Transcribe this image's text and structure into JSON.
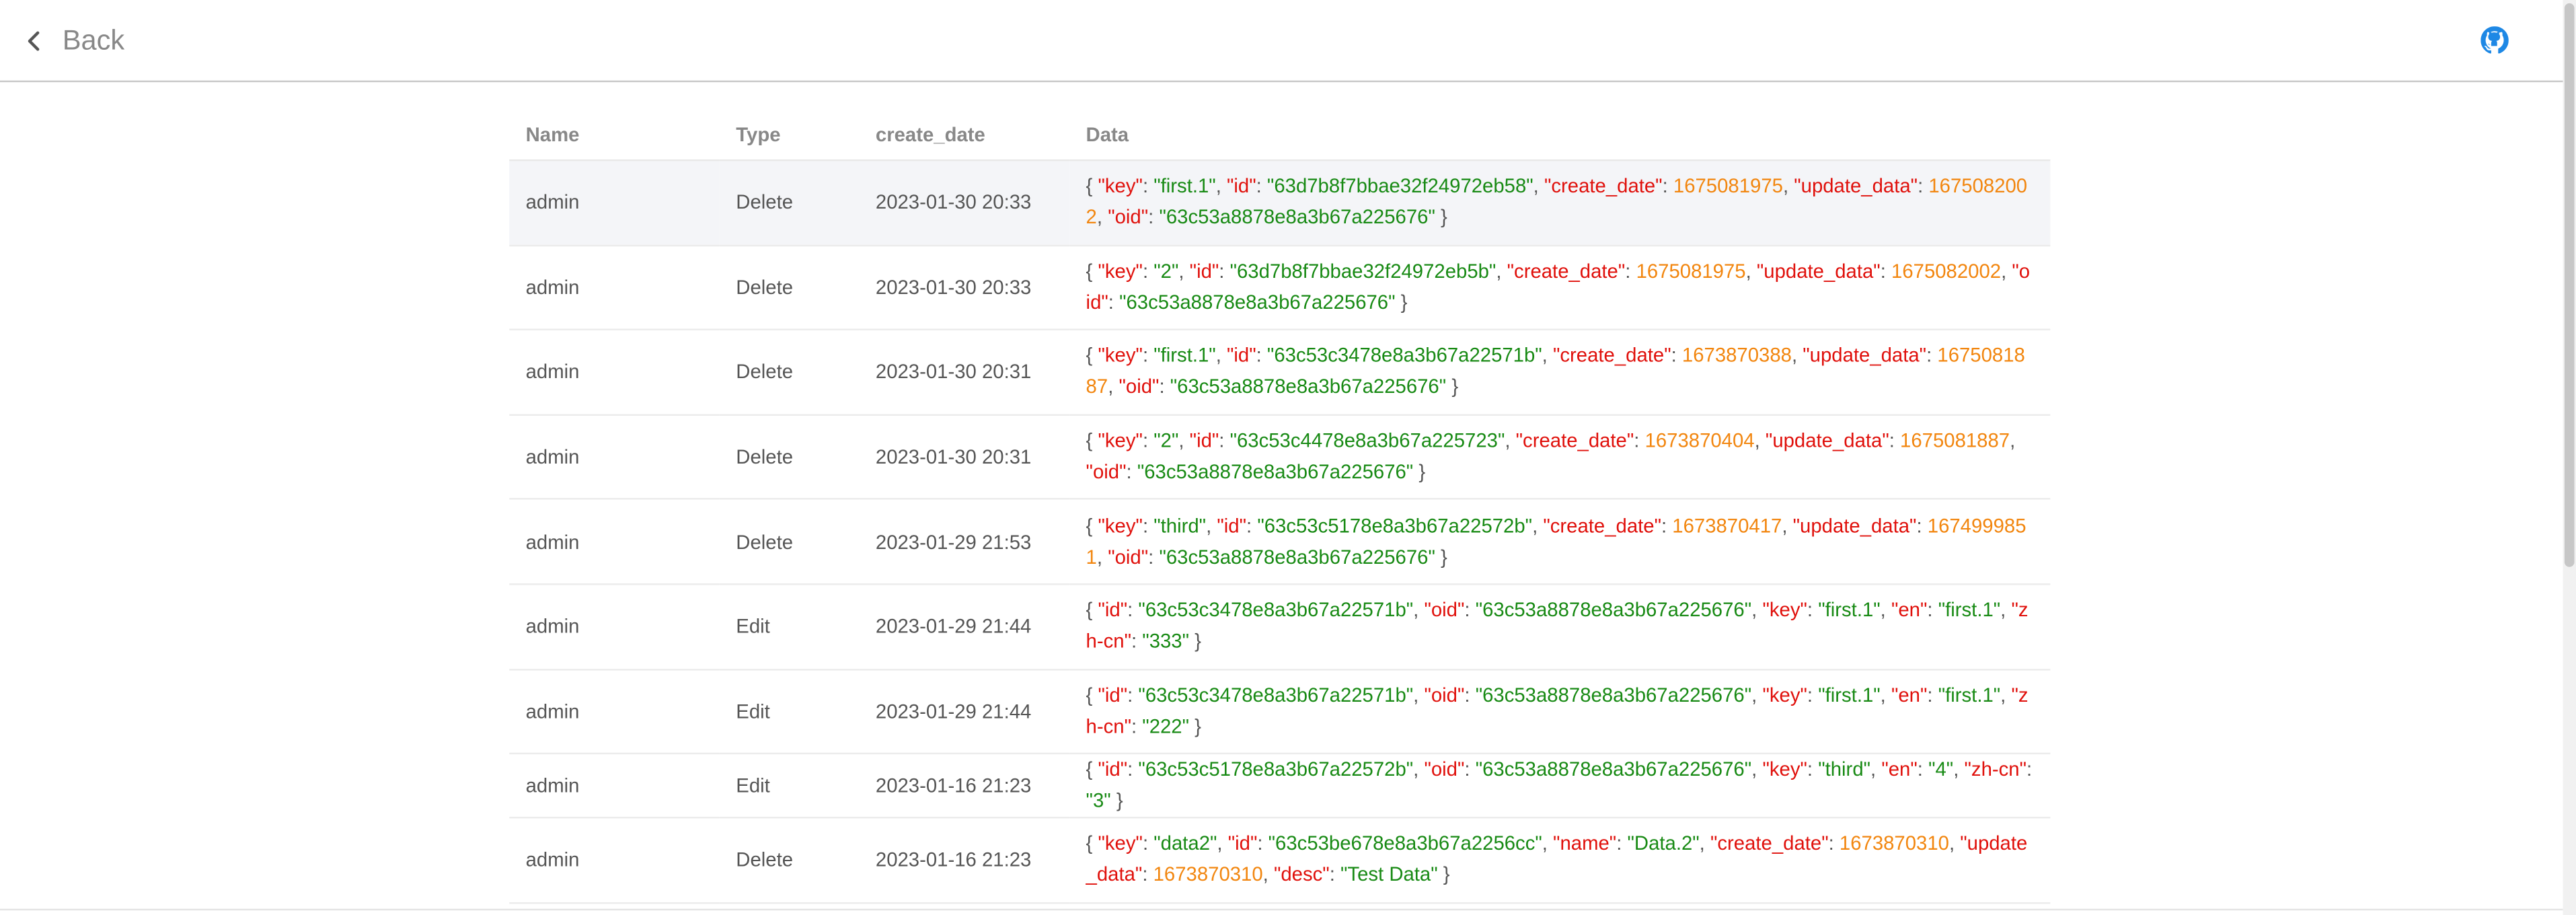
{
  "header": {
    "back_label": "Back",
    "back_icon": "chevron-left-icon",
    "github_icon": "github-icon"
  },
  "colors": {
    "json_key": "#e0100b",
    "json_string": "#188a14",
    "json_number": "#f2860f",
    "row_highlight": "#f4f5f8"
  },
  "table": {
    "columns": [
      "Name",
      "Type",
      "create_date",
      "Data"
    ],
    "rows": [
      {
        "name": "admin",
        "type": "Delete",
        "date": "2023-01-30 20:33",
        "data": [
          [
            "key",
            "first.1",
            "s"
          ],
          [
            "id",
            "63d7b8f7bbae32f24972eb58",
            "s"
          ],
          [
            "create_date",
            "1675081975",
            "n"
          ],
          [
            "update_data",
            "1675082002",
            "n"
          ],
          [
            "oid",
            "63c53a8878e8a3b67a225676",
            "s"
          ]
        ]
      },
      {
        "name": "admin",
        "type": "Delete",
        "date": "2023-01-30 20:33",
        "data": [
          [
            "key",
            "2",
            "s"
          ],
          [
            "id",
            "63d7b8f7bbae32f24972eb5b",
            "s"
          ],
          [
            "create_date",
            "1675081975",
            "n"
          ],
          [
            "update_data",
            "1675082002",
            "n"
          ],
          [
            "oid",
            "63c53a8878e8a3b67a225676",
            "s"
          ]
        ]
      },
      {
        "name": "admin",
        "type": "Delete",
        "date": "2023-01-30 20:31",
        "data": [
          [
            "key",
            "first.1",
            "s"
          ],
          [
            "id",
            "63c53c3478e8a3b67a22571b",
            "s"
          ],
          [
            "create_date",
            "1673870388",
            "n"
          ],
          [
            "update_data",
            "1675081887",
            "n"
          ],
          [
            "oid",
            "63c53a8878e8a3b67a225676",
            "s"
          ]
        ]
      },
      {
        "name": "admin",
        "type": "Delete",
        "date": "2023-01-30 20:31",
        "data": [
          [
            "key",
            "2",
            "s"
          ],
          [
            "id",
            "63c53c4478e8a3b67a225723",
            "s"
          ],
          [
            "create_date",
            "1673870404",
            "n"
          ],
          [
            "update_data",
            "1675081887",
            "n"
          ],
          [
            "oid",
            "63c53a8878e8a3b67a225676",
            "s"
          ]
        ]
      },
      {
        "name": "admin",
        "type": "Delete",
        "date": "2023-01-29 21:53",
        "data": [
          [
            "key",
            "third",
            "s"
          ],
          [
            "id",
            "63c53c5178e8a3b67a22572b",
            "s"
          ],
          [
            "create_date",
            "1673870417",
            "n"
          ],
          [
            "update_data",
            "1674999851",
            "n"
          ],
          [
            "oid",
            "63c53a8878e8a3b67a225676",
            "s"
          ]
        ]
      },
      {
        "name": "admin",
        "type": "Edit",
        "date": "2023-01-29 21:44",
        "data": [
          [
            "id",
            "63c53c3478e8a3b67a22571b",
            "s"
          ],
          [
            "oid",
            "63c53a8878e8a3b67a225676",
            "s"
          ],
          [
            "key",
            "first.1",
            "s"
          ],
          [
            "en",
            "first.1",
            "s"
          ],
          [
            "zh-cn",
            "333",
            "s"
          ]
        ]
      },
      {
        "name": "admin",
        "type": "Edit",
        "date": "2023-01-29 21:44",
        "data": [
          [
            "id",
            "63c53c3478e8a3b67a22571b",
            "s"
          ],
          [
            "oid",
            "63c53a8878e8a3b67a225676",
            "s"
          ],
          [
            "key",
            "first.1",
            "s"
          ],
          [
            "en",
            "first.1",
            "s"
          ],
          [
            "zh-cn",
            "222",
            "s"
          ]
        ]
      },
      {
        "name": "admin",
        "type": "Edit",
        "date": "2023-01-16 21:23",
        "data": [
          [
            "id",
            "63c53c5178e8a3b67a22572b",
            "s"
          ],
          [
            "oid",
            "63c53a8878e8a3b67a225676",
            "s"
          ],
          [
            "key",
            "third",
            "s"
          ],
          [
            "en",
            "4",
            "s"
          ],
          [
            "zh-cn",
            "3",
            "s"
          ]
        ]
      },
      {
        "name": "admin",
        "type": "Delete",
        "date": "2023-01-16 21:23",
        "data": [
          [
            "key",
            "data2",
            "s"
          ],
          [
            "id",
            "63c53be678e8a3b67a2256cc",
            "s"
          ],
          [
            "name",
            "Data.2",
            "s"
          ],
          [
            "create_date",
            "1673870310",
            "n"
          ],
          [
            "update_data",
            "1673870310",
            "n"
          ],
          [
            "desc",
            "Test Data",
            "s"
          ]
        ]
      }
    ]
  }
}
